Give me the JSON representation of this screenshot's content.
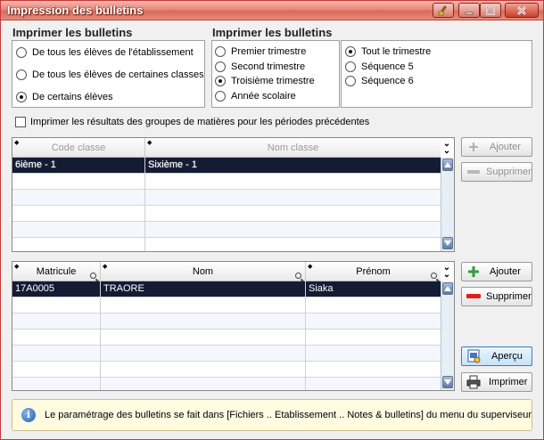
{
  "window": {
    "title": "Impression des bulletins"
  },
  "section1": {
    "title": "Imprimer les bulletins",
    "options": [
      {
        "label": "De tous les élèves de l'établissement",
        "selected": false
      },
      {
        "label": "De tous les élèves de certaines classes",
        "selected": false
      },
      {
        "label": "De certains élèves",
        "selected": true
      }
    ]
  },
  "section2": {
    "title": "Imprimer les bulletins",
    "periods": [
      {
        "label": "Premier trimestre",
        "selected": false
      },
      {
        "label": "Second trimestre",
        "selected": false
      },
      {
        "label": "Troisième trimestre",
        "selected": true
      },
      {
        "label": "Année scolaire",
        "selected": false
      }
    ],
    "sub_periods": [
      {
        "label": "Tout le trimestre",
        "selected": true
      },
      {
        "label": "Séquence 5",
        "selected": false
      },
      {
        "label": "Séquence 6",
        "selected": false
      }
    ]
  },
  "checkbox_prev": {
    "label": "Imprimer les résultats des groupes de matières pour les périodes précédentes",
    "checked": false
  },
  "classes_table": {
    "columns": [
      "Code classe",
      "Nom classe"
    ],
    "rows": [
      {
        "code": "6ième - 1",
        "nom": "Sixième - 1"
      }
    ]
  },
  "students_table": {
    "columns": [
      "Matricule",
      "Nom",
      "Prénom"
    ],
    "rows": [
      {
        "matricule": "17A0005",
        "nom": "TRAORE",
        "prenom": "Siaka"
      }
    ]
  },
  "buttons": {
    "classes_add": "Ajouter",
    "classes_remove": "Supprimer",
    "students_add": "Ajouter",
    "students_remove": "Supprimer",
    "preview": "Aperçu",
    "print": "Imprimer"
  },
  "info": {
    "text": "Le paramétrage des bulletins se fait dans [Fichiers .. Etablissement .. Notes & bulletins] du menu du superviseur"
  },
  "colors": {
    "titlebar": "#e8897a",
    "selection": "#141c34",
    "scrollbar": "#5c7aa5",
    "info_bg": "#fffbe0"
  }
}
